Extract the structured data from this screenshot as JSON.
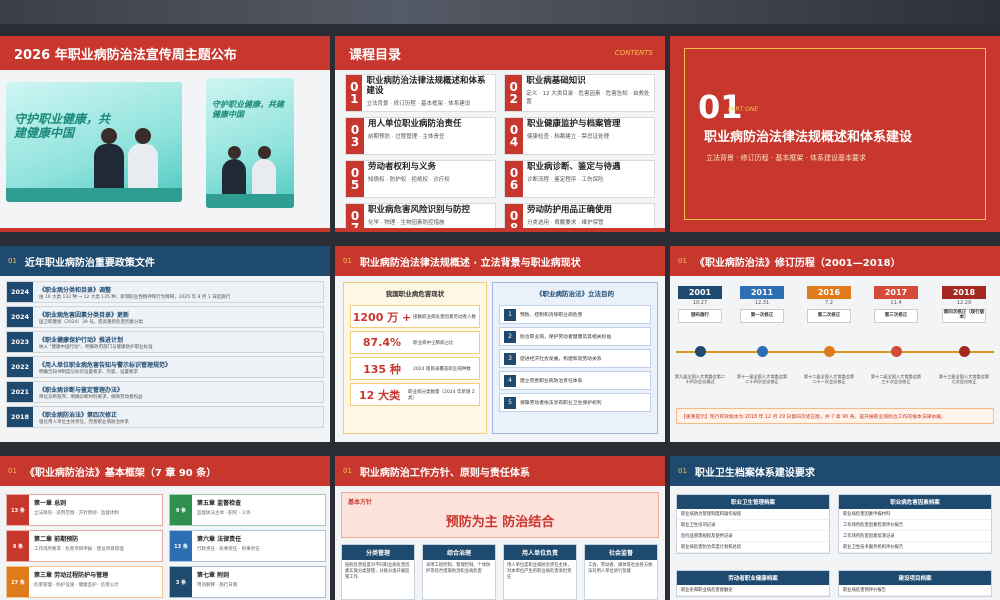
{
  "slides": {
    "s1": {
      "title": "2026 年职业病防治法宣传周主题公布",
      "poster_text_1": "守护职业健康，共建健康中国",
      "poster_text_2": "守护职业健康，共建健康中国"
    },
    "s2": {
      "title": "课程目录",
      "tag": "CONTENTS",
      "items": [
        {
          "n1": "0",
          "n2": "1",
          "h": "职业病防治法律法规概述和体系建设",
          "d": "立法背景 · 修订历程 · 基本框架 · 体系建设"
        },
        {
          "n1": "0",
          "n2": "2",
          "h": "职业病基础知识",
          "d": "定义 · 12 大类目录 · 危害因素 · 危害告知 · 自救处置"
        },
        {
          "n1": "0",
          "n2": "3",
          "h": "用人单位职业病防治责任",
          "d": "前期预防 · 过程管理 · 主体责任"
        },
        {
          "n1": "0",
          "n2": "4",
          "h": "职业健康监护与档案管理",
          "d": "健康检查 · 档案建立 · 禁忌证处理"
        },
        {
          "n1": "0",
          "n2": "5",
          "h": "劳动者权利与义务",
          "d": "知情权 · 防护权 · 拒绝权 · 诊疗权"
        },
        {
          "n1": "0",
          "n2": "6",
          "h": "职业病诊断、鉴定与待遇",
          "d": "诊断流程 · 鉴定程序 · 工伤保险"
        },
        {
          "n1": "0",
          "n2": "7",
          "h": "职业病危害风险识别与防控",
          "d": "化学 · 物理 · 生物因素防控措施"
        },
        {
          "n1": "0",
          "n2": "8",
          "h": "劳动防护用品正确使用",
          "d": "分类选用 · 佩戴要求 · 维护保管"
        }
      ]
    },
    "s3": {
      "num": "01",
      "part": "PART ONE",
      "title": "职业病防治法律法规概述和体系建设",
      "sub": "立法背景 · 修订历程 · 基本框架 · 体系建设基本要求"
    },
    "s4": {
      "num": "01",
      "title": "近年职业病防治重要政策文件",
      "items": [
        {
          "yr": "2024",
          "h": "《职业病分类和目录》调整",
          "d": "由 10 大类 132 种 → 12 大类 135 种，新增职业性精神和行为障碍，2025 年 8 月 1 日起施行"
        },
        {
          "yr": "2024",
          "h": "《职业病危害因素分类目录》更新",
          "d": "国卫职健发〔2024〕39 号，提高重新危害因素分类"
        },
        {
          "yr": "2023",
          "h": "《职业健康保护行动》推进计划",
          "d": "纳入 \"健康中国行动\"，明确政府部门与健康防护职业标准"
        },
        {
          "yr": "2022",
          "h": "《用人单位职业病危害告知与警示标识管理规范》",
          "d": "明确告知书制度与标识设置要求、内容、设置要求"
        },
        {
          "yr": "2021",
          "h": "《职业病诊断与鉴定管理办法》",
          "d": "简化诊断程序，明确诊断材料要求，保障劳动者权益"
        },
        {
          "yr": "2018",
          "h": "《职业病防治法》第四次修正",
          "d": "强化用人单位主体责任，完善职业病防治体系"
        }
      ]
    },
    "s5": {
      "num": "01",
      "title": "职业病防治法律法规概述 · 立法背景与职业病现状",
      "left_title": "我国职业病危害现状",
      "stats": [
        {
          "v": "1200 万 +",
          "l": "接触职业病危害因素劳动者人数"
        },
        {
          "v": "87.4%",
          "l": "职业病中尘肺病占比"
        },
        {
          "v": "135 种",
          "l": "2024 版目录覆盖职业病种数"
        },
        {
          "v": "12 大类",
          "l": "职业病分类数量（2024 年新增 2 类）"
        }
      ],
      "right_title": "《职业病防治法》立法目的",
      "goals": [
        {
          "n": "1",
          "t": "预防、控制和消除职业病危害"
        },
        {
          "n": "2",
          "t": "防治职业病，保护劳动者健康及其相关权益"
        },
        {
          "n": "3",
          "t": "促进经济社会发展，构建和谐劳动关系"
        },
        {
          "n": "4",
          "t": "建立完善职业病防治责任体系"
        },
        {
          "n": "5",
          "t": "保障劳动者依法享有职业卫生保护权利"
        }
      ]
    },
    "s6": {
      "num": "01",
      "title": "《职业病防治法》修订历程（2001—2018）",
      "timeline": [
        {
          "yr": "2001",
          "dt": "10.27",
          "lab": "颁布施行",
          "desc": "第九届全国人大常委会第二十四次会议通过",
          "color": "#1e4a70"
        },
        {
          "yr": "2011",
          "dt": "12.31",
          "lab": "第一次修正",
          "desc": "第十一届全国人大常委会第二十四次会议修正",
          "color": "#2d6fb3"
        },
        {
          "yr": "2016",
          "dt": "7.2",
          "lab": "第二次修正",
          "desc": "第十二届全国人大常委会第二十一次会议修正",
          "color": "#e07b1c"
        },
        {
          "yr": "2017",
          "dt": "11.4",
          "lab": "第三次修正",
          "desc": "第十二届全国人大常委会第三十次会议修正",
          "color": "#d64a3a"
        },
        {
          "yr": "2018",
          "dt": "12.29",
          "lab": "第四次修正（现行版本）",
          "desc": "第十三届全国人大常委会第七次会议修正",
          "color": "#a52722"
        }
      ],
      "note": "【重要提示】现行有效版本为 2018 年 12 月 29 日第四次修正版，共 7 章 90 条，是开展职业病防治工作的根本法律依据。"
    },
    "s7": {
      "num": "01",
      "title": "《职业病防治法》基本框架（7 章 90 条）",
      "chapters": [
        {
          "cn": "13 条",
          "h": "第一章 总则",
          "d": "立法目的 · 适用范围 · 方针原则 · 监督体制",
          "color": "#c8372d",
          "border": "#e6a9a2"
        },
        {
          "cn": "9 条",
          "h": "第五章 监督检查",
          "d": "监督执法主体 · 职权 · 义务",
          "color": "#2e8f4e",
          "border": "#9dd1ad"
        },
        {
          "cn": "9 条",
          "h": "第二章 前期预防",
          "d": "工作场所要求 · 危害项目申报 · 建设项目管理",
          "color": "#c8372d",
          "border": "#e6a9a2"
        },
        {
          "cn": "13 条",
          "h": "第六章 法律责任",
          "d": "行政责任 · 民事责任 · 刑事责任",
          "color": "#2d6fb3",
          "border": "#a9c4e6"
        },
        {
          "cn": "27 条",
          "h": "第三章 劳动过程防护与管理",
          "d": "危害管理 · 防护设施 · 健康监护 · 危害公示",
          "color": "#e07b1c",
          "border": "#f1c391"
        },
        {
          "cn": "3 条",
          "h": "第七章 附则",
          "d": "用语解释 · 施行日期",
          "color": "#1e4a70",
          "border": "#a9bccf"
        }
      ]
    },
    "s8": {
      "num": "01",
      "title": "职业病防治工作方针、原则与责任体系",
      "base_label": "基本方针",
      "base_value": "预防为主  防治结合",
      "cols": [
        {
          "h": "分类管理",
          "d": "按照危害程度对不同职业病危害因素实施分类管理，分级分类开展监管工作"
        },
        {
          "h": "综合治理",
          "d": "采用工程控制、管理控制、个体防护等综合措施防治职业病危害"
        },
        {
          "h": "用人单位负责",
          "d": "用人单位是职业病防治责任主体，对本单位产生的职业病危害承担责任"
        },
        {
          "h": "社会监督",
          "d": "工会、劳动者、媒体等社会各方依法对用人单位进行监督"
        }
      ]
    },
    "s9": {
      "num": "01",
      "title": "职业卫生档案体系建设要求",
      "cards": [
        {
          "h": "职业卫生管理档案",
          "items": [
            "职业病防治管理制度和操作规程",
            "职业卫生培训记录",
            "危险品管理规程及使用记录",
            "职业病危害防治年度计划和总结"
          ]
        },
        {
          "h": "职业病危害因素档案",
          "items": [
            "职业病危害因素申报材料",
            "工作场所危害因素检测评价报告",
            "工作场所危害因素监测记录",
            "职业卫生技术服务机构评价报告"
          ]
        },
        {
          "h": "劳动者职业健康档案",
          "items": [
            "职业史和职业病危害接触史"
          ]
        },
        {
          "h": "建设项目档案",
          "items": [
            "职业病危害预评价报告"
          ]
        }
      ]
    }
  }
}
